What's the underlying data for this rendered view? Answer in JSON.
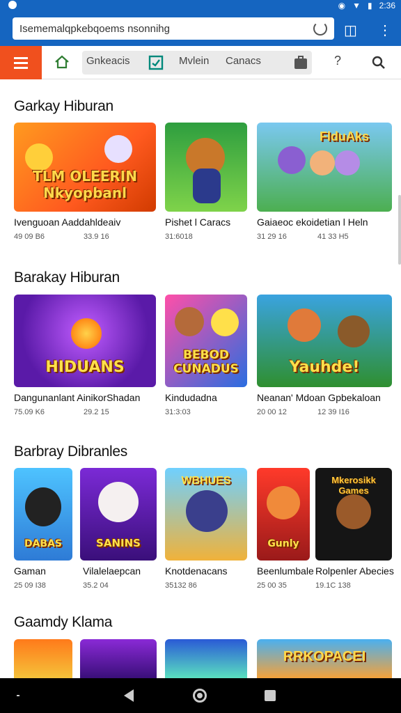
{
  "status": {
    "time": "2:36"
  },
  "browser": {
    "url": "Isememalqpkebqoems nsonnihg"
  },
  "tabs": [
    {
      "label": "Gnkeacis"
    },
    {
      "label": "Mvlein"
    },
    {
      "label": "Canacs"
    }
  ],
  "sections": [
    {
      "title": "Garkay Hiburan",
      "cards": [
        {
          "art": "TLM OLEERIN Nkyopbanl",
          "caption": "Ivenguoan Aaddahldeaiv",
          "meta": [
            "49 09 B6",
            "33.9 16"
          ]
        },
        {
          "art": "",
          "caption": "Pishet l Caracs",
          "meta": [
            "31:6018"
          ]
        },
        {
          "art": "FlduAks",
          "caption": "Gaiaeoc ekoidetian l Heln",
          "meta": [
            "31 29 16",
            "41 33 H5"
          ]
        }
      ]
    },
    {
      "title": "Barakay Hiburan",
      "cards": [
        {
          "art": "HIDUANS",
          "caption": "Dangunanlant  AinikorShadan",
          "meta": [
            "75.09 K6",
            "29.2 15"
          ]
        },
        {
          "art": "BEBOD CUNADUS",
          "caption": "Kindudadna",
          "meta": [
            "31:3:03"
          ]
        },
        {
          "art": "Yauhde!",
          "caption": "Neanan' Mdoan  Gpbekaloan",
          "meta": [
            "20 00 12",
            "12 39 I16"
          ]
        }
      ]
    },
    {
      "title": "Barbray Dibranles",
      "cards": [
        {
          "art": "DABAS",
          "caption": "Gaman",
          "meta": [
            "25 09 I38"
          ]
        },
        {
          "art": "SANINS",
          "caption": "Vilalelaepcan",
          "meta": [
            "35.2 04"
          ]
        },
        {
          "art": "WBHUES",
          "caption": "Knotdenacans",
          "meta": [
            "35132 86"
          ]
        },
        {
          "art": "Gunly",
          "caption": "Beenlumbale",
          "meta": [
            "25 00 35"
          ]
        },
        {
          "art": "Mkerosikk Games",
          "caption": "Rolpenler Abecies",
          "meta": [
            "19.1C 138"
          ]
        }
      ]
    },
    {
      "title": "Gaamdy Klama",
      "cards": [
        {
          "art": ""
        },
        {
          "art": ""
        },
        {
          "art": ""
        },
        {
          "art": "RRKOPACEI"
        }
      ]
    }
  ],
  "colors": {
    "accent": "#1565c0",
    "menu": "#f0501e"
  }
}
